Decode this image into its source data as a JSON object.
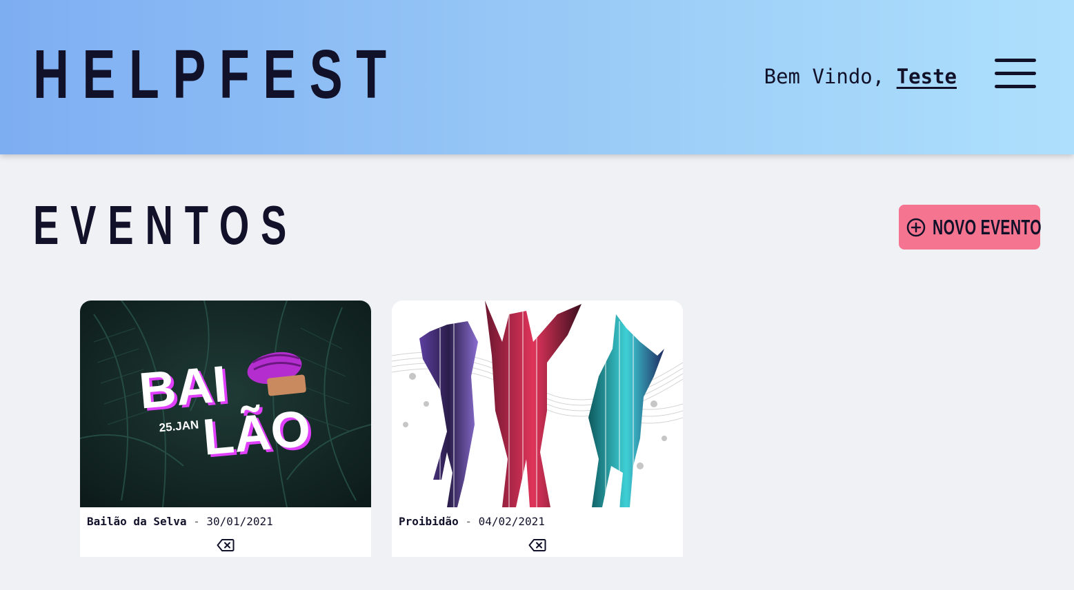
{
  "header": {
    "logo": "HELPFEST",
    "welcome_prefix": "Bem Vindo, ",
    "user_name": "Teste",
    "menu_icon": "hamburger-menu-icon"
  },
  "main": {
    "title": "EVENTOS",
    "new_event_label": "NOVO EVENTO",
    "new_event_icon": "plus-circle-icon"
  },
  "events": [
    {
      "name": "Bailão da Selva",
      "separator": " - ",
      "date": "30/01/2021",
      "poster": {
        "word_top": "BAI",
        "word_bottom": "LÃO",
        "date_tag": "25.JAN"
      },
      "delete_icon": "backspace-icon"
    },
    {
      "name": "Proibidão",
      "separator": " - ",
      "date": "04/02/2021",
      "delete_icon": "backspace-icon"
    }
  ],
  "colors": {
    "header_gradient_start": "#7eaef2",
    "header_gradient_end": "#aee0fd",
    "background": "#f0f1f5",
    "accent_button": "#f57590",
    "text_dark": "#12112a",
    "poster_magenta": "#e040fb"
  }
}
